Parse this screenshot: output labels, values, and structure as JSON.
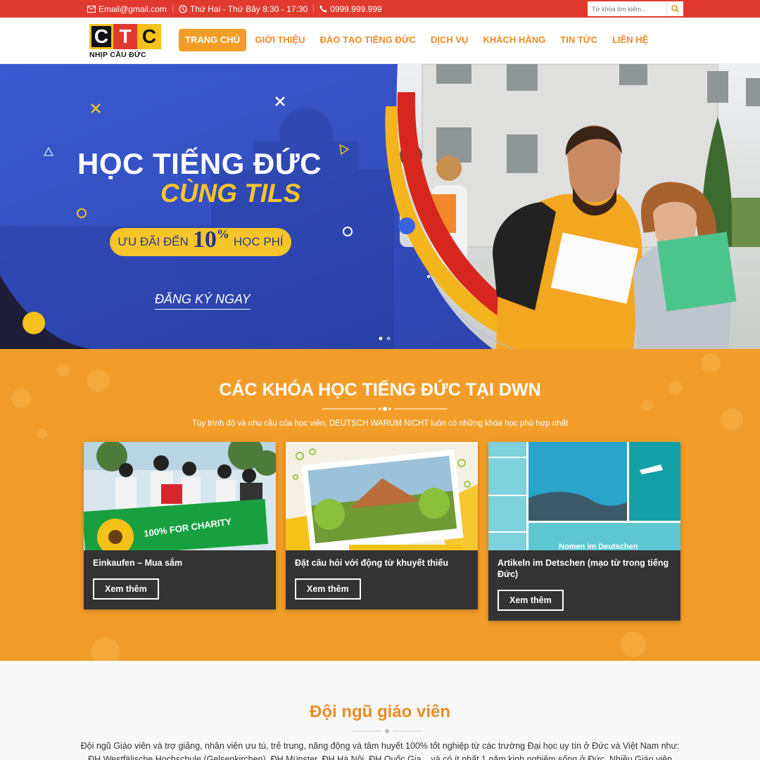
{
  "topbar": {
    "email": "Email@gmail.com",
    "hours": "Thứ Hai - Thứ Bảy 8:30 - 17:30",
    "phone": "0999.999.999",
    "search_placeholder": "Từ khóa tìm kiếm..."
  },
  "logo": {
    "letters": [
      "C",
      "T",
      "C"
    ],
    "tagline": "NHỊP CẦU ĐỨC"
  },
  "nav": {
    "items": [
      {
        "label": "TRANG CHỦ"
      },
      {
        "label": "GIỚI THIỆU"
      },
      {
        "label": "ĐÀO TẠO TIẾNG ĐỨC"
      },
      {
        "label": "DỊCH VỤ"
      },
      {
        "label": "KHÁCH HÀNG"
      },
      {
        "label": "TIN TỨC"
      },
      {
        "label": "LIÊN HỆ"
      }
    ],
    "active_index": 0
  },
  "hero": {
    "line1": "HỌC TIẾNG ĐỨC",
    "line2": "CÙNG TILS",
    "promo_before": "ƯU ĐÃI ĐẾN",
    "promo_number": "10",
    "promo_unit": "%",
    "promo_after": "HỌC PHÍ",
    "cta": "ĐĂNG KÝ NGAY",
    "slide_count": 2,
    "active_slide": 0
  },
  "courses": {
    "title": "CÁC KHÓA HỌC TIẾNG ĐỨC TẠI DWN",
    "subtitle": "Tùy trình độ và nhu cầu của học viên, DEUTSCH WARUM NICHT luôn có những khóa học phù hợp nhất",
    "cards": [
      {
        "title": "Einkaufen – Mua sắm",
        "button": "Xem thêm",
        "image_text": "100% FOR CHARITY"
      },
      {
        "title": "Đặt câu hỏi với động từ khuyết thiếu",
        "button": "Xem thêm"
      },
      {
        "title": "Artikeln im Detschen (mạo từ trong tiếng Đức)",
        "button": "Xem thêm",
        "image_text": "Nomen im Deutschen"
      }
    ]
  },
  "teachers": {
    "title": "Đội ngũ giáo viên",
    "description": "Đội ngũ Giáo viên và trợ giảng, nhân viên ưu tú, trẻ trung, năng động và tâm huyết 100% tốt nghiệp từ các trường Đại học uy tín ở Đức và Việt Nam như: ĐH Westfälische Hochschule (Gelsenkirchen), ĐH Münster, ĐH Hà Nội, ĐH Quốc Gia... và có ít nhất 1 năm kinh nghiệm sống ở Đức. Nhiều Giáo viên đang công"
  },
  "colors": {
    "topbar": "#e03a2f",
    "accent": "#f29d25",
    "nav_text": "#ea8c26",
    "hero_blue": "#2f4fbf",
    "hero_yellow": "#f7c52a",
    "courses_bg": "#f29d2a",
    "card_bg": "#333333"
  },
  "icons": {
    "email": "envelope-icon",
    "hours": "clock-icon",
    "phone": "phone-icon",
    "search": "search-icon"
  }
}
